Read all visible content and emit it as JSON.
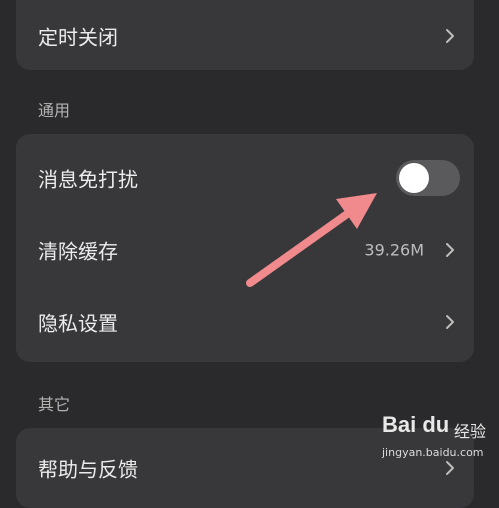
{
  "top_section": {
    "rows": [
      {
        "label": "定时关闭"
      }
    ]
  },
  "general_section": {
    "title": "通用",
    "dnd": {
      "label": "消息免打扰",
      "enabled": false
    },
    "clear_cache": {
      "label": "清除缓存",
      "value": "39.26M"
    },
    "privacy": {
      "label": "隐私设置"
    }
  },
  "other_section": {
    "title": "其它",
    "rows": [
      {
        "label": "帮助与反馈"
      }
    ]
  },
  "annotation": {
    "arrow_color": "#f08a8c"
  },
  "watermark": {
    "logo": "Bai du",
    "cn": "经验",
    "url": "jingyan.baidu.com"
  },
  "colors": {
    "background": "#2a2a2c",
    "card": "#38383b",
    "text": "#ececec",
    "toggle_track": "#5a5a5d"
  },
  "icons": {
    "chevron": "chevron-right-icon",
    "toggle_knob": "toggle-knob"
  }
}
